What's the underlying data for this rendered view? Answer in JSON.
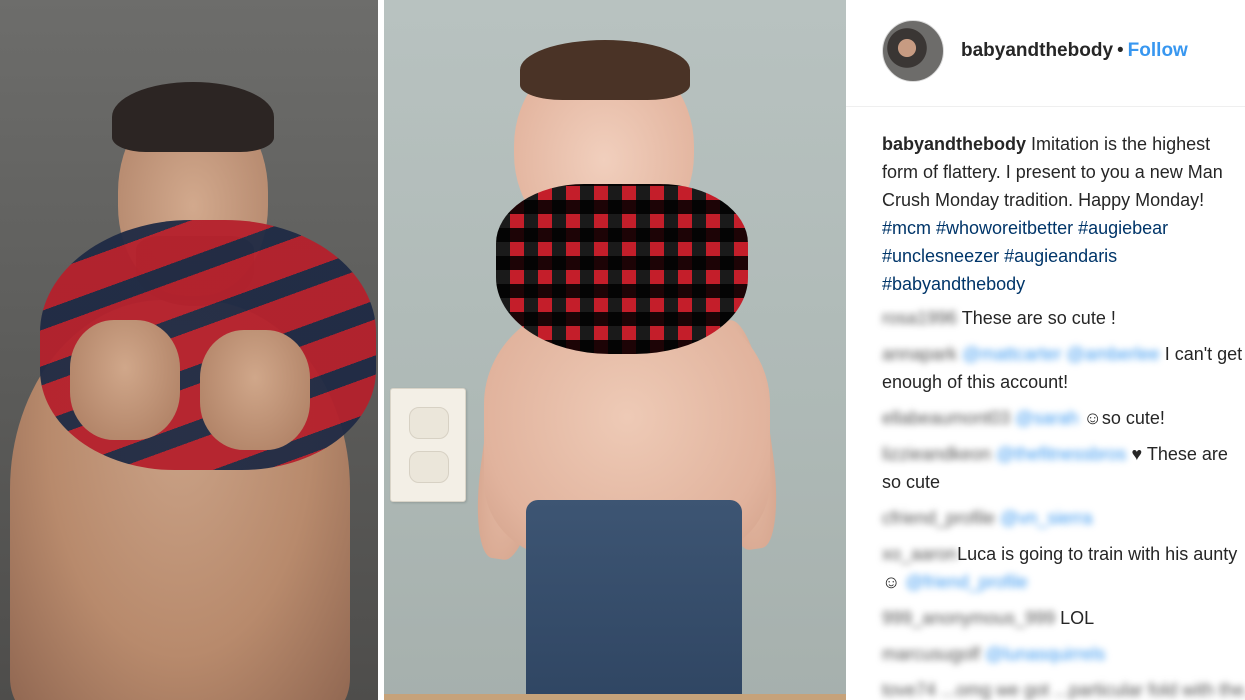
{
  "post": {
    "username": "babyandthebody",
    "separator": "•",
    "follow_label": "Follow",
    "caption_user": "babyandthebody",
    "caption_text": " Imitation is the highest form of flattery. I present to you a new Man Crush Monday tradition. Happy Monday!",
    "hashtags": [
      "#mcm",
      "#whoworeitbetter",
      "#augiebear",
      "#unclesneezer",
      "#augieandaris",
      "#babyandthebody"
    ]
  },
  "comments": [
    {
      "user": "rosa1996",
      "mention": "",
      "text": "These are so cute !"
    },
    {
      "user": "annapark",
      "mention": "@mattcarter @amberlee",
      "text": "I can't get enough of this account!"
    },
    {
      "user": "ellabeaumont03",
      "mention": "@sarah",
      "text": "so cute!",
      "emoji": "☺"
    },
    {
      "user": "lizzieandkeon",
      "mention": "@thefitnessbros",
      "text": "These are so cute",
      "emoji": "♥"
    },
    {
      "user": "cfriend_profile",
      "mention": "@vn_sierra",
      "text": ""
    },
    {
      "user": "xo_aaron",
      "mention": "",
      "text": "Luca is going to train with his aunty",
      "emoji": "☺",
      "trailing_mention": "@friend_profile"
    },
    {
      "user": "999_anonymous_999",
      "mention": "",
      "text": "LOL"
    },
    {
      "user": "marcusugolf",
      "mention": "@lunasquirrels",
      "text": ""
    },
    {
      "user": "tove74",
      "mention": "",
      "text": "...omg we got ...particular fold with the..."
    }
  ],
  "icons": {
    "avatar": "avatar-photo",
    "outlet": "wall-outlet"
  },
  "colors": {
    "link": "#3897f0",
    "hashtag": "#003569",
    "text": "#262626"
  }
}
